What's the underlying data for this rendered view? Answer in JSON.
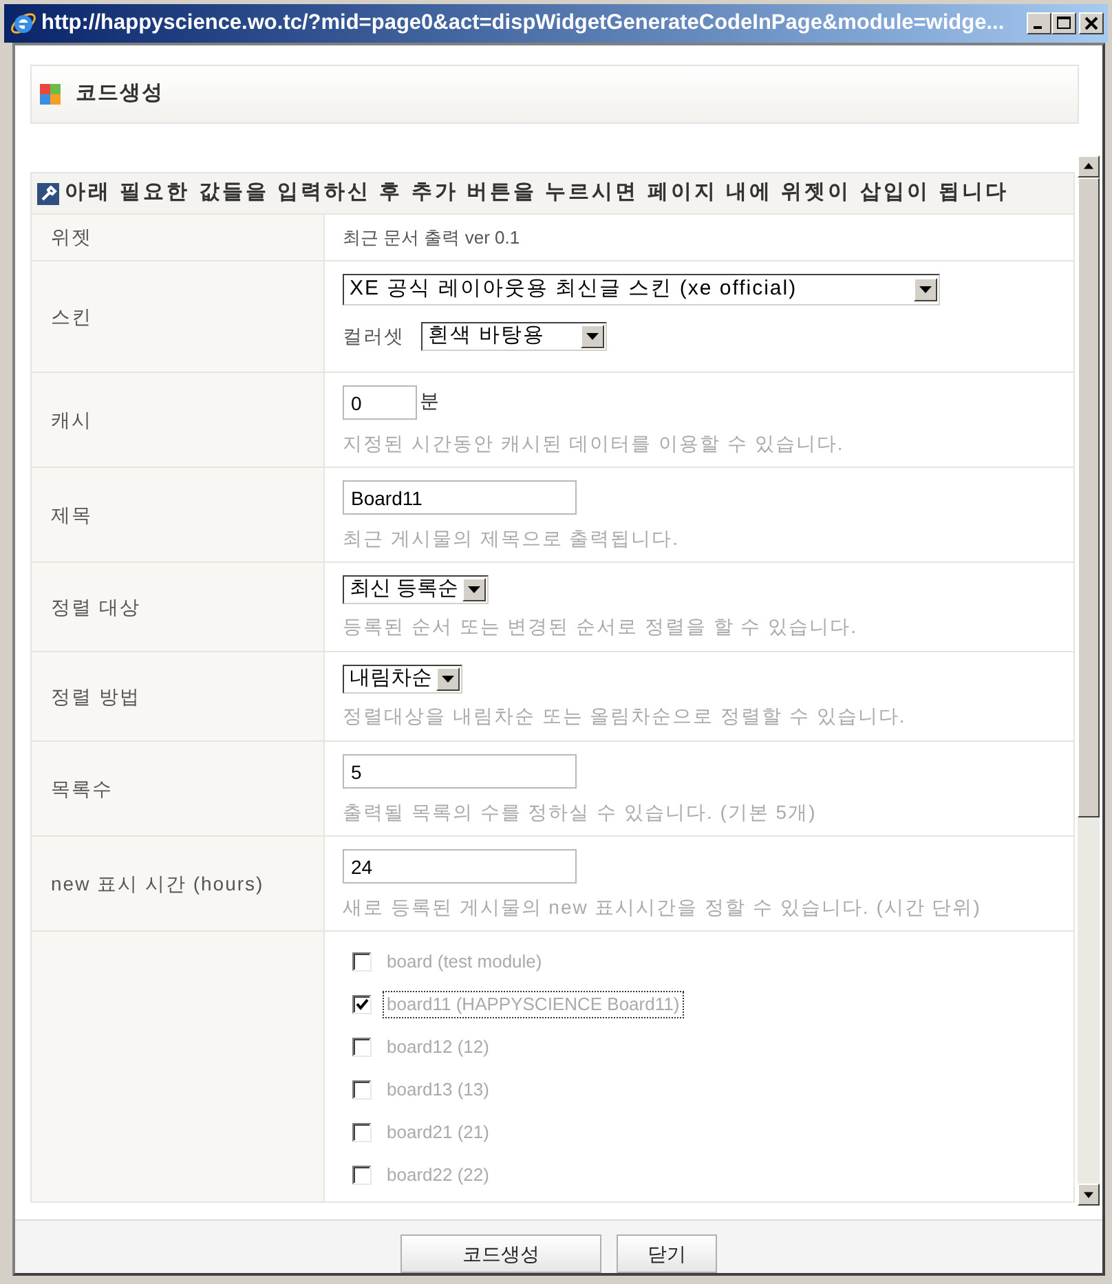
{
  "window": {
    "title": "http://happyscience.wo.tc/?mid=page0&act=dispWidgetGenerateCodeInPage&module=widge..."
  },
  "header": {
    "title": "코드생성"
  },
  "form": {
    "instruction": "아래 필요한 값들을 입력하신 후 추가 버튼을 누르시면 페이지 내에 위젯이 삽입이 됩니다",
    "rows": [
      {
        "kind": "text",
        "label": "위젯",
        "value": "최근 문서 출력 ver 0.1"
      },
      {
        "kind": "skin",
        "label": "스킨",
        "value": "XE 공식 레이아웃용 최신글 스킨 (xe official)",
        "colorset_label": "컬러셋",
        "colorset": "흰색 바탕용"
      },
      {
        "kind": "short_input",
        "label": "캐시",
        "value": "0",
        "unit": "분",
        "hint": "지정된 시간동안 캐시된 데이터를 이용할 수 있습니다."
      },
      {
        "kind": "input",
        "label": "제목",
        "value": "Board11",
        "hint": "최근 게시물의 제목으로 출력됩니다."
      },
      {
        "kind": "select",
        "label": "정렬 대상",
        "value": "최신 등록순",
        "hint": "등록된 순서 또는 변경된 순서로 정렬을 할 수 있습니다."
      },
      {
        "kind": "select",
        "label": "정렬 방법",
        "value": "내림차순",
        "hint": "정렬대상을 내림차순 또는 올림차순으로 정렬할 수 있습니다."
      },
      {
        "kind": "input",
        "label": "목록수",
        "value": "5",
        "hint": "출력될 목록의 수를 정하실 수 있습니다. (기본 5개)"
      },
      {
        "kind": "input",
        "label": "new 표시 시간 (hours)",
        "value": "24",
        "hint": "새로 등록된 게시물의 new 표시시간을 정할 수 있습니다. (시간 단위)"
      },
      {
        "kind": "checklist",
        "items": [
          {
            "label": "board (test module)",
            "checked": false,
            "focused": false
          },
          {
            "label": "board11 (HAPPYSCIENCE Board11)",
            "checked": true,
            "focused": true
          },
          {
            "label": "board12 (12)",
            "checked": false,
            "focused": false
          },
          {
            "label": "board13 (13)",
            "checked": false,
            "focused": false
          },
          {
            "label": "board21 (21)",
            "checked": false,
            "focused": false
          },
          {
            "label": "board22 (22)",
            "checked": false,
            "focused": false
          }
        ]
      }
    ]
  },
  "buttons": [
    {
      "label": "코드생성",
      "kind": "wide"
    },
    {
      "label": "닫기",
      "kind": "narrow"
    }
  ]
}
